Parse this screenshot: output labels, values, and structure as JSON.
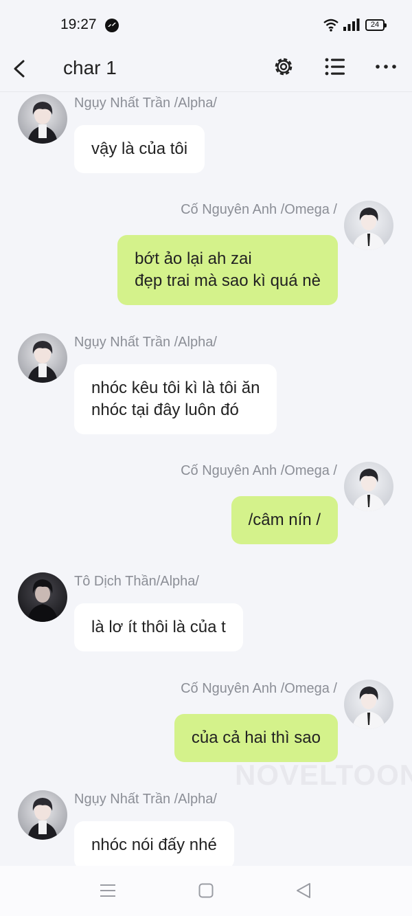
{
  "status_bar": {
    "time": "19:27",
    "battery": "24"
  },
  "header": {
    "title": "char 1"
  },
  "watermark": "NOVELTOON",
  "messages": [
    {
      "side": "left",
      "sender": "Ngụy Nhất Trần /Alpha/",
      "lines": [
        "vậy là của tôi"
      ]
    },
    {
      "side": "right",
      "sender": "Cố Nguyên Anh /Omega /",
      "lines": [
        "bớt ảo lại ah zai",
        "đẹp trai mà sao kì quá nè"
      ]
    },
    {
      "side": "left",
      "sender": "Ngụy Nhất Trần /Alpha/",
      "lines": [
        "nhóc kêu tôi kì là tôi ăn",
        "nhóc tại đây luôn đó"
      ]
    },
    {
      "side": "right",
      "sender": "Cố Nguyên Anh /Omega /",
      "lines": [
        "/câm nín /"
      ]
    },
    {
      "side": "left",
      "sender": "Tô Dịch Thần/Alpha/",
      "lines": [
        "là lơ ít thôi là của t"
      ]
    },
    {
      "side": "right",
      "sender": "Cố Nguyên Anh /Omega /",
      "lines": [
        "của cả hai thì sao"
      ]
    },
    {
      "side": "left",
      "sender": "Ngụy Nhất Trần /Alpha/",
      "lines": [
        "nhóc nói đấy nhé"
      ]
    }
  ]
}
